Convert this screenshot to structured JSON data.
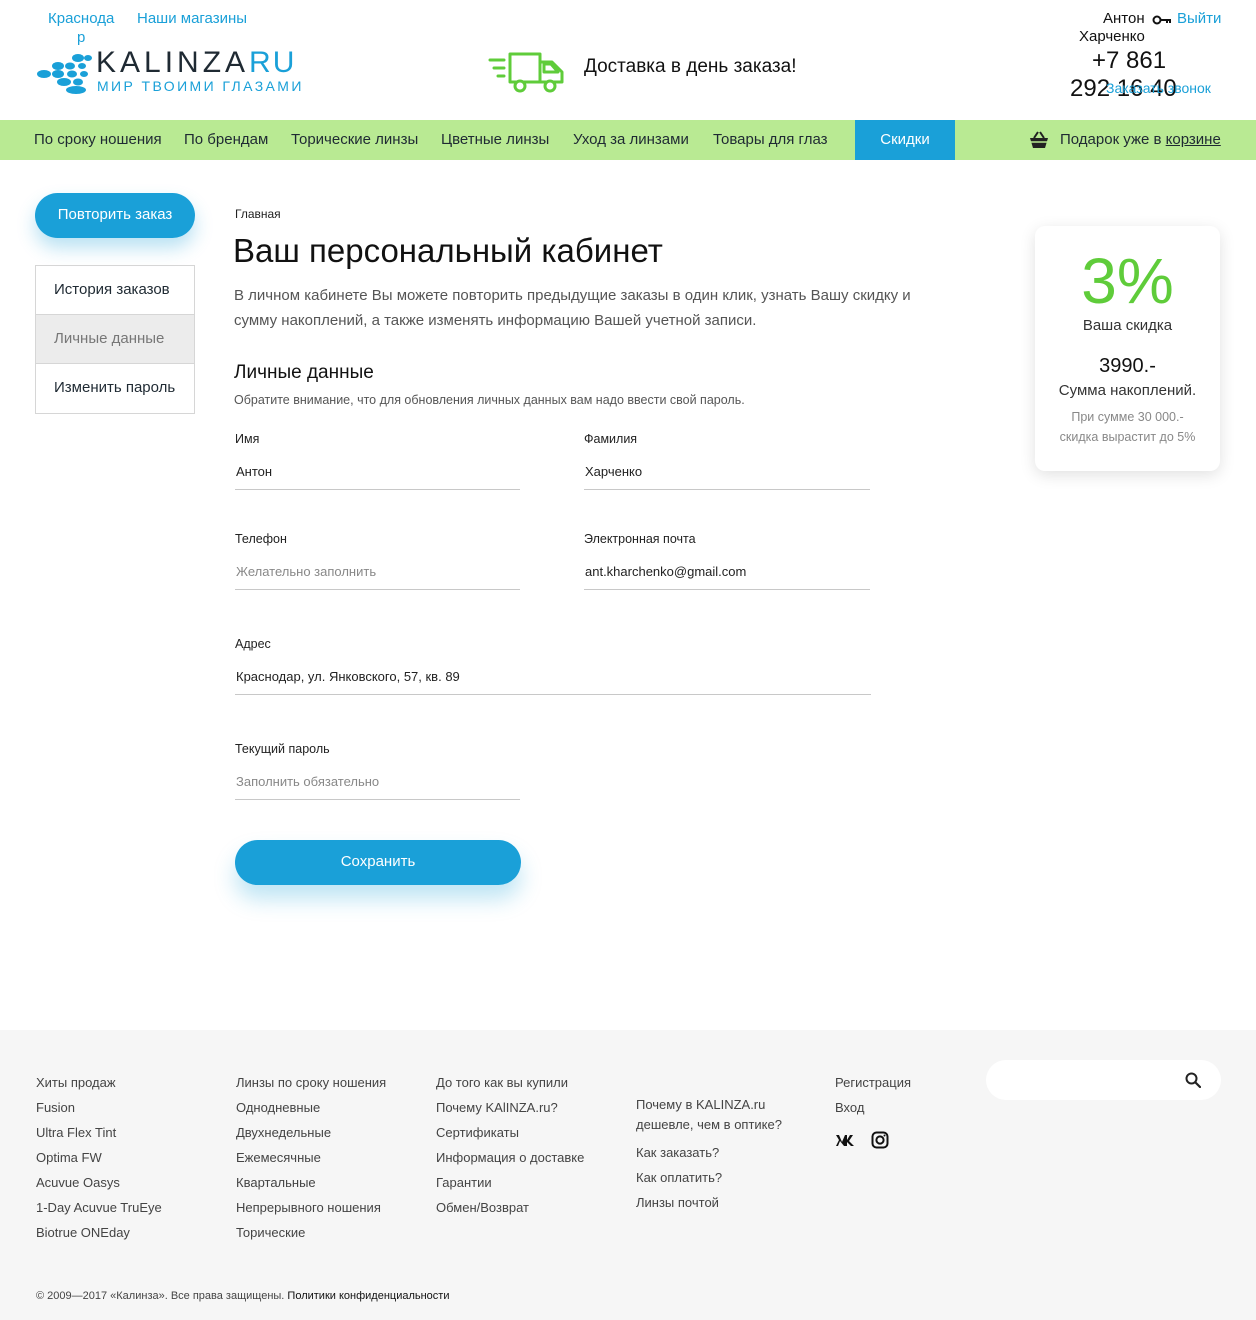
{
  "header": {
    "city_line1": "Краснода",
    "city_line2": "р",
    "stores_link": "Наши магазины",
    "logo_main": "KALINZA",
    "logo_ru": "RU",
    "logo_sub": "МИР ТВОИМИ ГЛАЗАМИ",
    "delivery_text": "Доставка в день заказа!",
    "user_first_name": "Антон",
    "user_last_name": "Харченко",
    "logout": "Выйти",
    "phone_line1": "+7 861",
    "phone_line2": "292 16 40",
    "callback": "Заказать звонок",
    "accent_color": "#1aa0d8",
    "green_color": "#5fcc3a",
    "nav_bg_color": "#b9ea93"
  },
  "nav": {
    "items": [
      {
        "label": "По сроку ношения"
      },
      {
        "label": "По брендам"
      },
      {
        "label": "Торические линзы"
      },
      {
        "label": "Цветные линзы"
      },
      {
        "label": "Уход за линзами"
      },
      {
        "label": "Товары для глаз"
      }
    ],
    "sale": "Скидки",
    "gift_text": "Подарок уже в ",
    "gift_link": "корзине"
  },
  "sidebar": {
    "repeat_button": "Повторить заказ",
    "items": [
      {
        "label": "История заказов",
        "active": false
      },
      {
        "label": "Личные данные",
        "active": true
      },
      {
        "label": "Изменить пароль",
        "active": false
      }
    ]
  },
  "main": {
    "breadcrumb": "Главная",
    "title": "Ваш персональный кабинет",
    "intro": "В личном кабинете Вы можете повторить предыдущие заказы в один клик, узнать Вашу скидку и сумму накоплений, а также изменять информацию Вашей учетной записи.",
    "section_title": "Личные данные",
    "section_note": "Обратите внимание, что для обновления личных данных вам надо ввести свой пароль.",
    "fields": {
      "first_name": {
        "label": "Имя",
        "value": "Антон",
        "placeholder": ""
      },
      "last_name": {
        "label": "Фамилия",
        "value": "Харченко",
        "placeholder": ""
      },
      "phone": {
        "label": "Телефон",
        "value": "",
        "placeholder": "Желательно заполнить"
      },
      "email": {
        "label": "Электронная почта",
        "value": "ant.kharchenko@gmail.com",
        "placeholder": ""
      },
      "address": {
        "label": "Адрес",
        "value": "Краснодар, ул. Янковского, 57, кв. 89",
        "placeholder": ""
      },
      "password": {
        "label": "Текущий пароль",
        "value": "",
        "placeholder": "Заполнить обязательно"
      }
    },
    "save_button": "Сохранить"
  },
  "discount_card": {
    "percent": "3%",
    "percent_label": "Ваша скидка",
    "sum": "3990.-",
    "sum_label": "Сумма накоплений.",
    "note_line1": "При сумме 30 000.-",
    "note_line2": "скидка вырастит до 5%"
  },
  "footer": {
    "col1": [
      "Хиты продаж",
      "Fusion",
      "Ultra Flex Tint",
      "Optima FW",
      "Acuvue Oasys",
      "1-Day Acuvue TruEye",
      "Biotrue ONEday"
    ],
    "col2": [
      "Линзы по сроку ношения",
      "Однодневные",
      "Двухнедельные",
      "Ежемесячные",
      "Квартальные",
      "Непрерывного ношения",
      "Торические"
    ],
    "col3": [
      "До того как вы купили",
      "Почему KAlINZA.ru?",
      "Сертификаты",
      "Информация о доставке",
      "Гарантии",
      "Обмен/Возврат"
    ],
    "col4": [
      "Почему в KALINZA.ru",
      "дешевле, чем в оптике?",
      "Как заказать?",
      "Как оплатить?",
      "Линзы почтой"
    ],
    "col5": [
      "Регистрация",
      "Вход"
    ],
    "social_icons": [
      "vk-icon",
      "instagram-icon"
    ],
    "copyright": "© 2009—2017 «Калинза». Все права защищены. ",
    "policy_link": "Политики конфиденциальности"
  }
}
